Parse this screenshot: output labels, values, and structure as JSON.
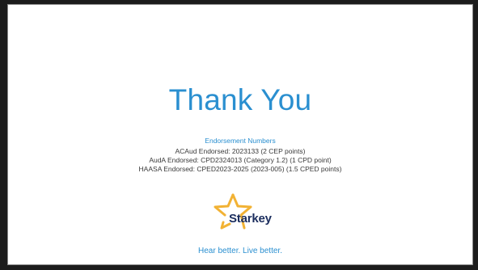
{
  "slide": {
    "title": "Thank You",
    "endorsement_heading": "Endorsement Numbers",
    "endorsements": [
      "ACAud Endorsed:  2023133 (2 CEP points)",
      "AudA Endorsed:  CPD2324013 (Category 1.2)  (1 CPD point)",
      "HAASA Endorsed:  CPED2023-2025 (2023-005) (1.5 CPED points)"
    ],
    "logo_text": "Starkey",
    "tagline": "Hear better. Live better."
  },
  "colors": {
    "accent_blue": "#2a8fd0",
    "body_text": "#3a3a3a",
    "logo_navy": "#1b2d5e",
    "logo_star": "#f2b234",
    "frame": "#1c1c1c"
  },
  "icons": {
    "logo_mark": "star-icon"
  }
}
